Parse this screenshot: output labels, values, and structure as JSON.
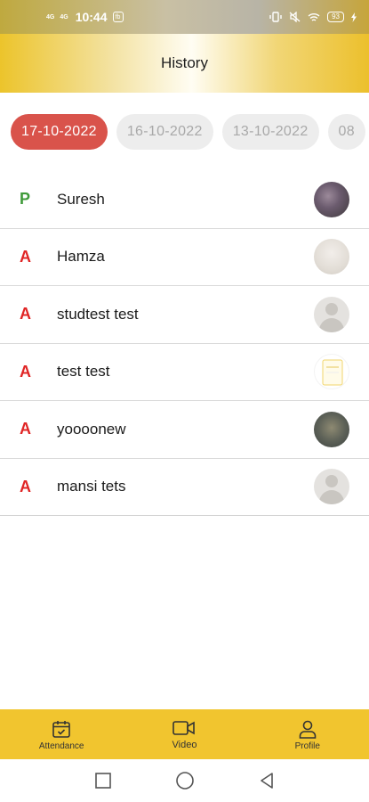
{
  "status_bar": {
    "network_1": "4G",
    "network_2": "4G",
    "time": "10:44",
    "app_badge": "fb",
    "battery": "93"
  },
  "header": {
    "title": "History"
  },
  "dates": [
    {
      "label": "17-10-2022",
      "active": true
    },
    {
      "label": "16-10-2022",
      "active": false
    },
    {
      "label": "13-10-2022",
      "active": false
    },
    {
      "label": "08",
      "active": false
    }
  ],
  "students": [
    {
      "status": "P",
      "name": "Suresh"
    },
    {
      "status": "A",
      "name": "Hamza"
    },
    {
      "status": "A",
      "name": "studtest test"
    },
    {
      "status": "A",
      "name": "test test"
    },
    {
      "status": "A",
      "name": "yoooonew"
    },
    {
      "status": "A",
      "name": "mansi tets"
    }
  ],
  "colors": {
    "present": "#3f9a3a",
    "absent": "#e02525",
    "accent": "#f1c52f",
    "active_chip": "#d9534b"
  },
  "bottom_nav": [
    {
      "label": "Attendance",
      "icon": "calendar-check-icon"
    },
    {
      "label": "Video",
      "icon": "video-camera-icon"
    },
    {
      "label": "Profile",
      "icon": "user-icon"
    }
  ],
  "android_nav": {
    "recent": "square-icon",
    "home": "circle-icon",
    "back": "triangle-back-icon"
  }
}
